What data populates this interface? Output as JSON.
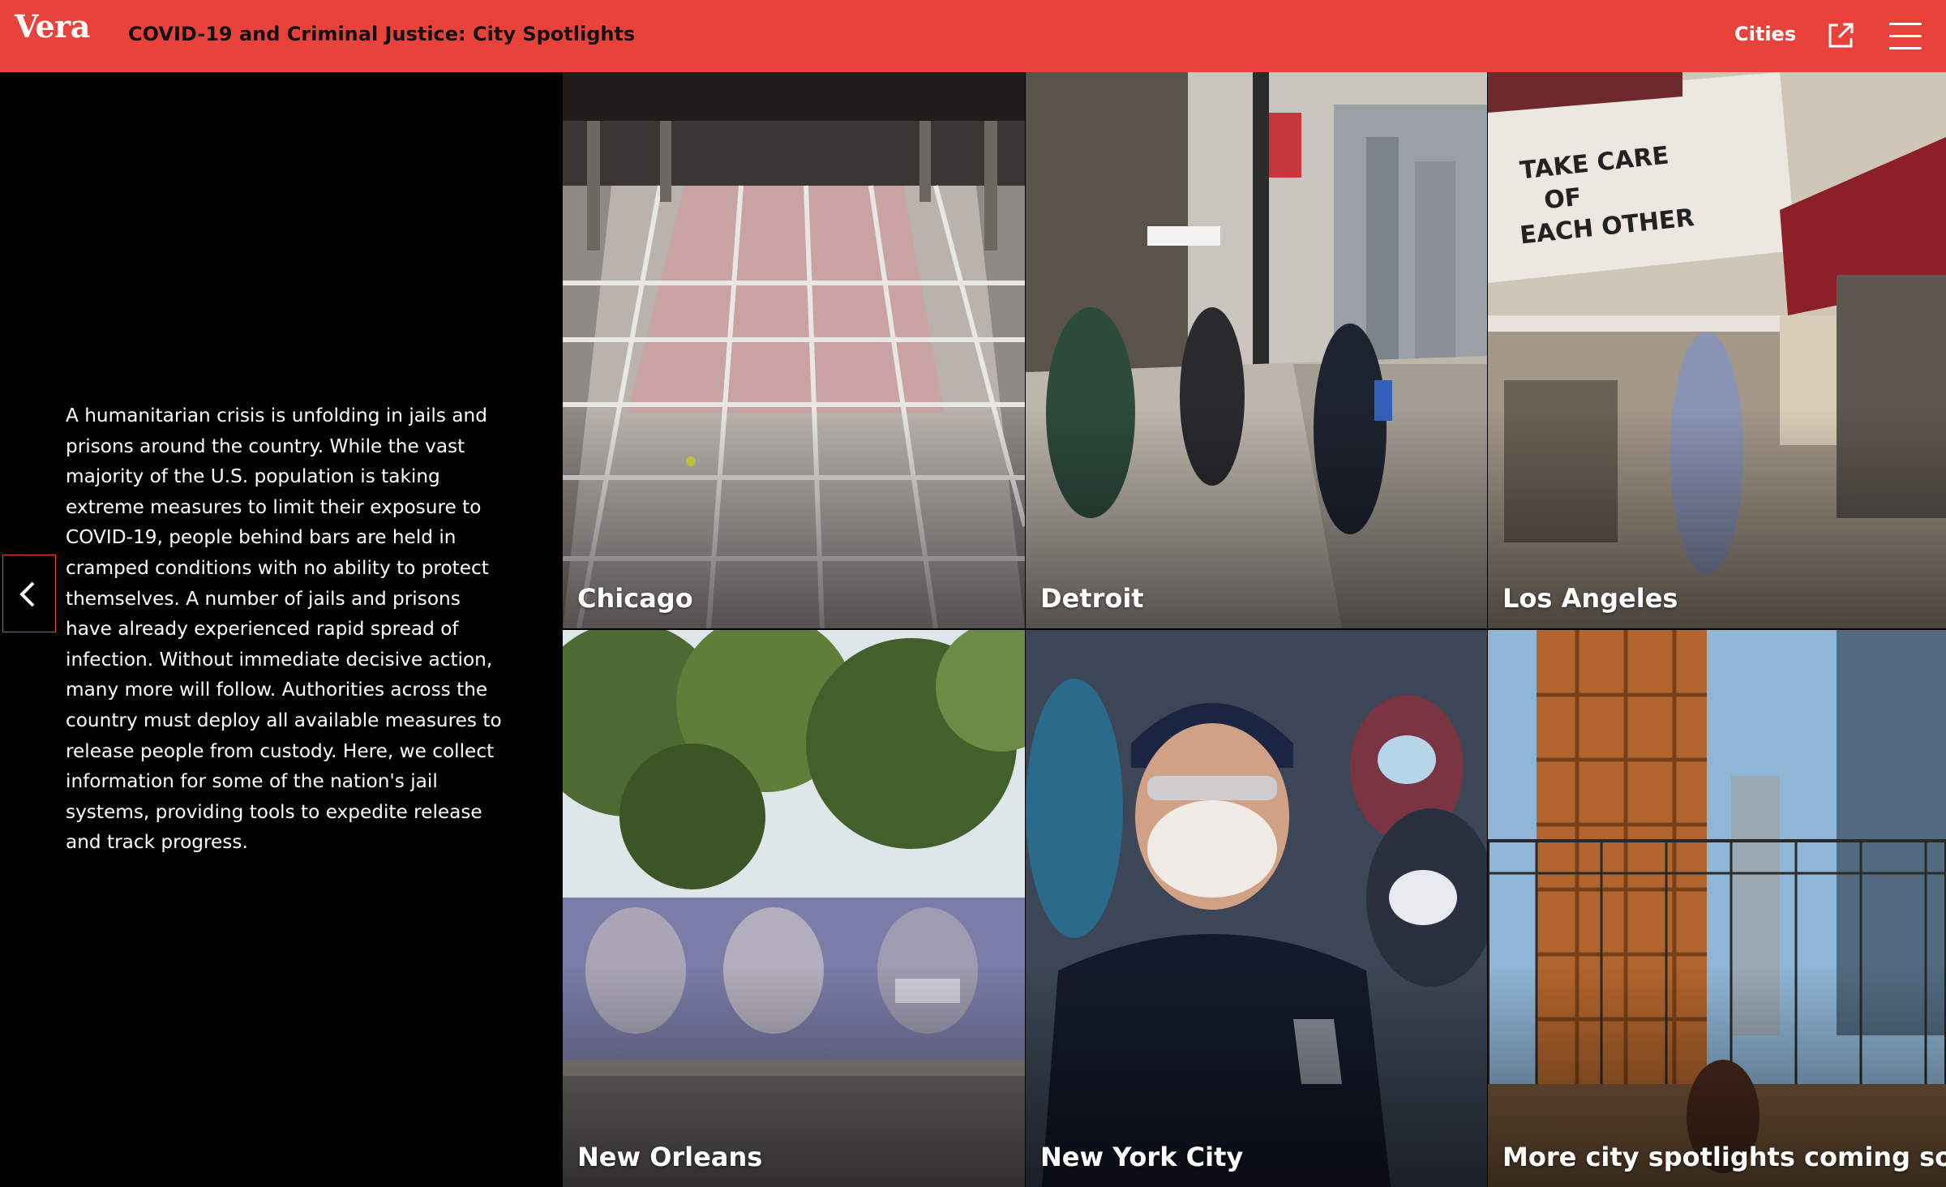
{
  "header": {
    "logo": "Vera",
    "title": "COVID-19 and Criminal Justice: City Spotlights",
    "nav_cities": "Cities",
    "accent_color": "#e8423a"
  },
  "intro": {
    "text": "A humanitarian crisis is unfolding in jails and prisons around the country. While the vast majority of the U.S. population is taking extreme measures to limit their exposure to COVID-19, people behind bars are held in cramped conditions with no ability to protect themselves. A number of jails and prisons have already experienced rapid spread of infection. Without immediate decisive action, many more will follow. Authorities across the country must deploy all available measures to release people from custody. Here, we collect information for some of the nation's jail systems, providing tools to expedite release and track progress."
  },
  "icons": {
    "back": "chevron-left-icon",
    "external": "external-link-icon",
    "menu": "hamburger-menu-icon"
  },
  "cities": [
    {
      "label": "Chicago"
    },
    {
      "label": "Detroit"
    },
    {
      "label": "Los Angeles"
    },
    {
      "label": "New Orleans"
    },
    {
      "label": "New York City"
    },
    {
      "label": "More city spotlights coming soon"
    }
  ]
}
